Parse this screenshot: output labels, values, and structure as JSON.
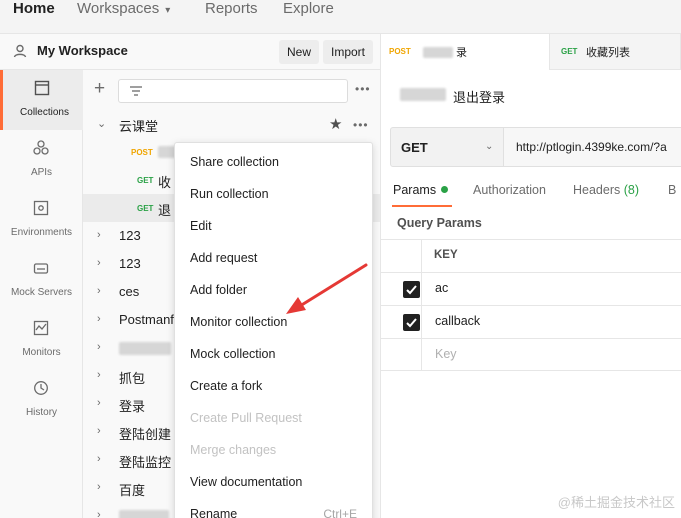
{
  "topnav": {
    "home": "Home",
    "workspaces": "Workspaces",
    "reports": "Reports",
    "explore": "Explore"
  },
  "workspace": {
    "name": "My Workspace",
    "new_label": "New",
    "import_label": "Import"
  },
  "rail": [
    {
      "label": "Collections",
      "icon": "collections-icon"
    },
    {
      "label": "APIs",
      "icon": "apis-icon"
    },
    {
      "label": "Environments",
      "icon": "environments-icon"
    },
    {
      "label": "Mock Servers",
      "icon": "mock-servers-icon"
    },
    {
      "label": "Monitors",
      "icon": "monitors-icon"
    },
    {
      "label": "History",
      "icon": "history-icon"
    }
  ],
  "collections": {
    "root": {
      "name": "云课堂"
    },
    "requests": [
      {
        "method": "POST",
        "name": ""
      },
      {
        "method": "GET",
        "name": "收"
      },
      {
        "method": "GET",
        "name": "退"
      }
    ],
    "items": [
      "123",
      "123",
      "ces",
      "Postmanf",
      "",
      "抓包",
      "登录",
      "登陆创建",
      "登陆监控",
      "百度"
    ]
  },
  "context_menu": {
    "items": [
      {
        "label": "Share collection",
        "disabled": false
      },
      {
        "label": "Run collection",
        "disabled": false
      },
      {
        "label": "Edit",
        "disabled": false
      },
      {
        "label": "Add request",
        "disabled": false
      },
      {
        "label": "Add folder",
        "disabled": false
      },
      {
        "label": "Monitor collection",
        "disabled": false
      },
      {
        "label": "Mock collection",
        "disabled": false
      },
      {
        "label": "Create a fork",
        "disabled": false
      },
      {
        "label": "Create Pull Request",
        "disabled": true
      },
      {
        "label": "Merge changes",
        "disabled": true
      },
      {
        "label": "View documentation",
        "disabled": false
      },
      {
        "label": "Rename",
        "disabled": false,
        "shortcut": "Ctrl+E"
      }
    ]
  },
  "tabs": [
    {
      "method": "POST",
      "label": "录"
    },
    {
      "method": "GET",
      "label": "收藏列表"
    }
  ],
  "request": {
    "title": "退出登录",
    "method": "GET",
    "url": "http://ptlogin.4399ke.com/?a"
  },
  "request_tabs": {
    "params": "Params",
    "authorization": "Authorization",
    "headers": "Headers",
    "headers_count": "(8)",
    "more": "B"
  },
  "query_params": {
    "title": "Query Params",
    "key_header": "KEY",
    "rows": [
      {
        "key": "ac",
        "checked": true
      },
      {
        "key": "callback",
        "checked": true
      }
    ],
    "placeholder": "Key"
  },
  "watermark": "@稀土掘金技术社区",
  "colors": {
    "accent": "#ff6c37",
    "post": "#f0a500",
    "get": "#2aa146",
    "annotation_arrow": "#e53935"
  }
}
